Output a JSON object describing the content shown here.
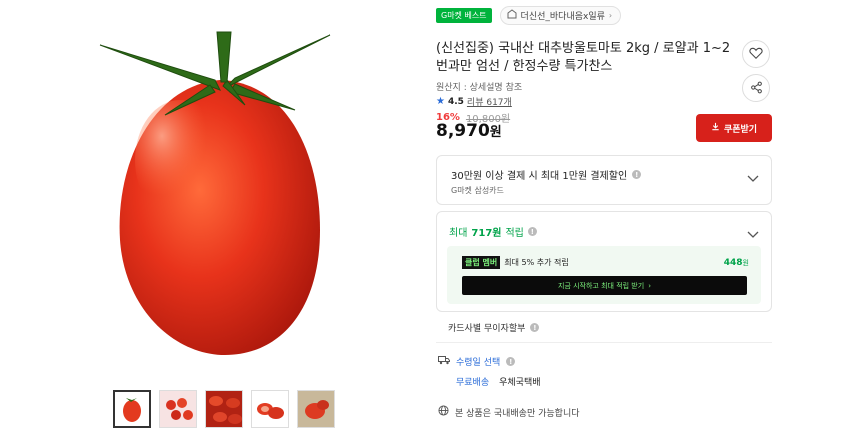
{
  "badge": "G마켓 베스트",
  "seller": {
    "name": "더신선_바다내음x일류",
    "chevron": "›"
  },
  "product": {
    "title": "(신선집중) 국내산 대추방울토마토 2kg / 로얄과 1~2번과만 엄선 / 한정수량 특가찬스",
    "origin": "원산지 : 상세설명 참조",
    "rating": "4.5",
    "reviews": "리뷰 617개",
    "discount_rate": "16%",
    "original_price": "10,800원",
    "price": "8,970",
    "price_unit": "원"
  },
  "coupon_button": "쿠폰받기",
  "payment_benefit": {
    "title": "30만원 이상 결제 시 최대 1만원 결제할인",
    "sub": "G마켓 삼성카드"
  },
  "points": {
    "prefix": "최대",
    "amount": "717원",
    "suffix": "적립",
    "member_badge": "클럽 멤버",
    "member_text": "최대 5% 추가 적립",
    "member_amount": "448",
    "member_unit": "원",
    "cta": "지금 시작하고 최대 적립 받기"
  },
  "card_installment": "카드사별 무이자할부",
  "shipping": {
    "title": "수령일 선택",
    "fee_label": "무료배송",
    "fee_value": "우체국택배"
  },
  "domestic_notice": "본 상품은 국내배송만 가능합니다",
  "colors": {
    "accent_green": "#00a34a",
    "coupon_red": "#d7211b",
    "discount_red": "#f03c3c",
    "link_blue": "#2b6cd8"
  },
  "icons": [
    "heart-icon",
    "share-icon",
    "download-icon",
    "star-icon",
    "truck-icon",
    "globe-icon",
    "chevron-down-icon",
    "info-icon"
  ]
}
